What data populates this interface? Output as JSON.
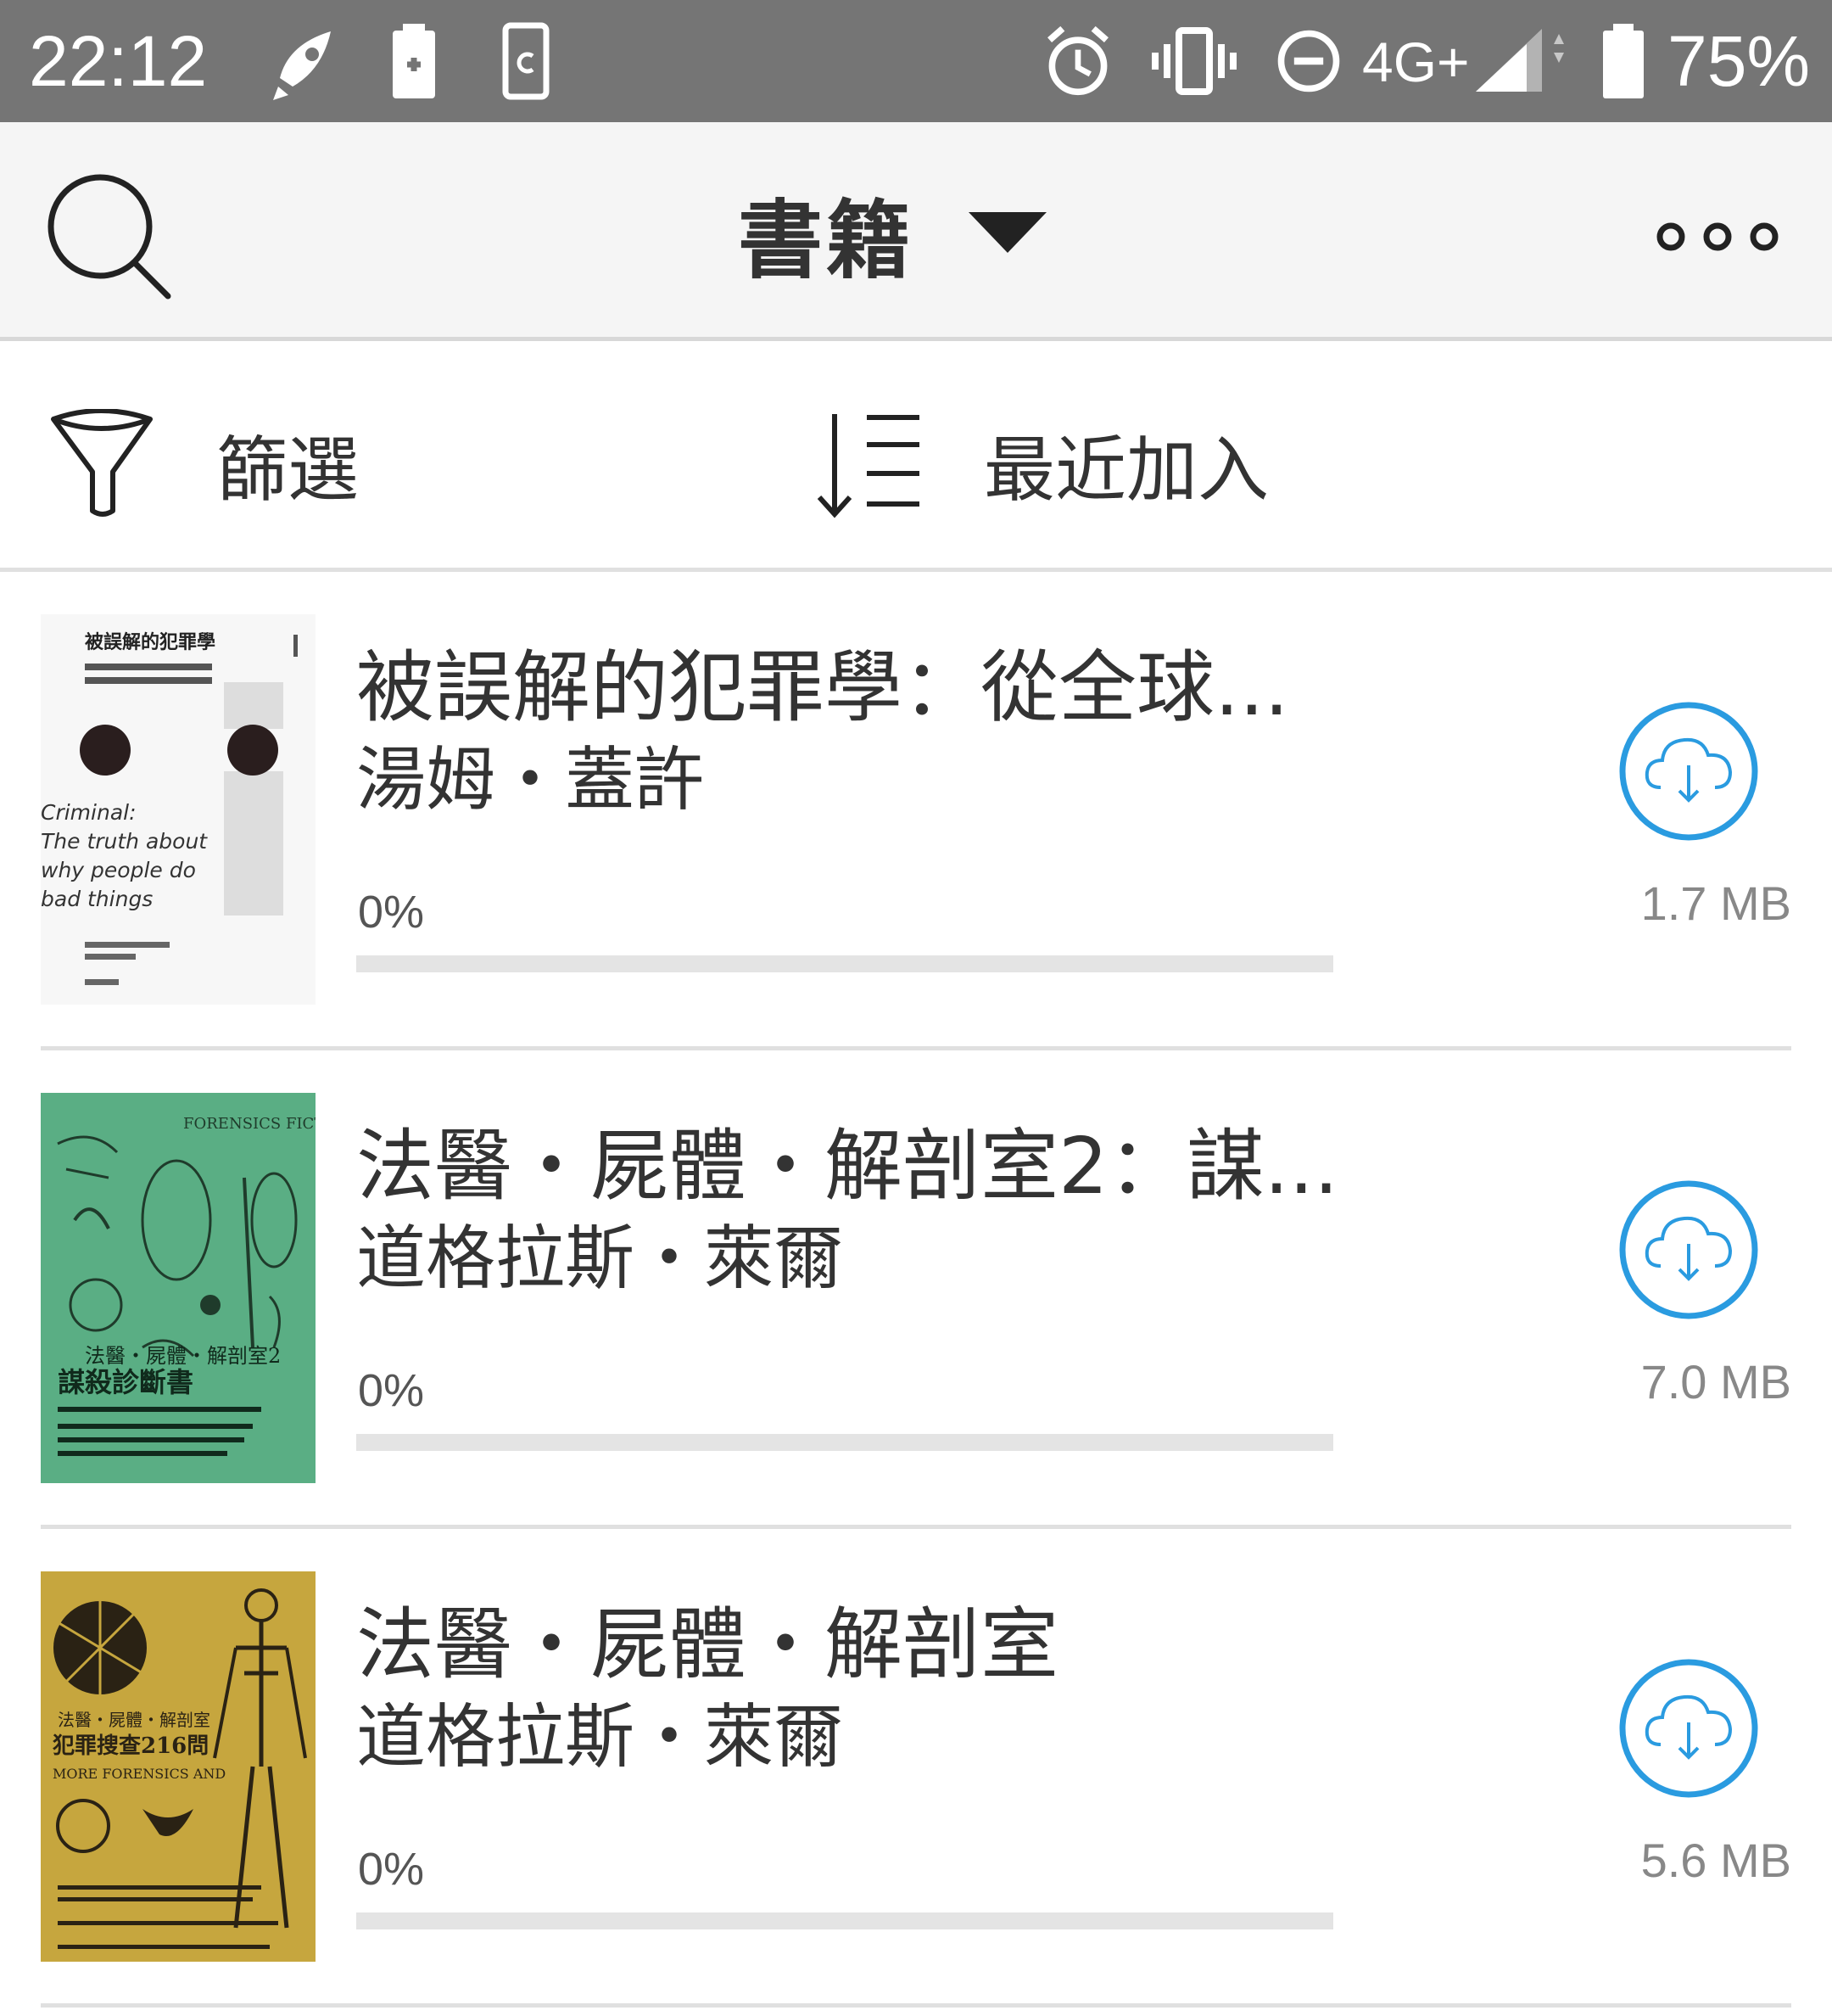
{
  "status_bar": {
    "time": "22:12",
    "network": "4G+",
    "battery_percent": "75%",
    "icons": [
      "rocket-icon",
      "battery-saver-icon",
      "screen-rotate-icon",
      "alarm-icon",
      "vibrate-icon",
      "do-not-disturb-icon",
      "signal-icon",
      "battery-icon"
    ]
  },
  "app_bar": {
    "title": "書籍",
    "icons": [
      "search-icon",
      "dropdown-arrow-icon",
      "more-options-icon"
    ]
  },
  "filter_bar": {
    "filter_label": "篩選",
    "sort_label": "最近加入",
    "icons": [
      "funnel-icon",
      "sort-descending-icon"
    ]
  },
  "books": [
    {
      "title": "被誤解的犯罪學：從全球...",
      "author": "湯姆・蓋許",
      "progress_text": "0%",
      "progress": 0,
      "size": "1.7 MB",
      "cover": {
        "bg": "#f7f7f7",
        "title": "被誤解的犯罪學",
        "english": [
          "Criminal:",
          "The truth about",
          "why people do",
          "bad things"
        ]
      }
    },
    {
      "title": "法醫・屍體・解剖室2：謀...",
      "author": "道格拉斯・萊爾",
      "progress_text": "0%",
      "progress": 0,
      "size": "7.0 MB",
      "cover": {
        "bg": "#5aae84",
        "title": "法醫・屍體・解剖室2",
        "subtitle": "謀殺診斷書",
        "english": "FORENSICS FICTION"
      }
    },
    {
      "title": "法醫・屍體・解剖室",
      "author": "道格拉斯・萊爾",
      "progress_text": "0%",
      "progress": 0,
      "size": "5.6 MB",
      "cover": {
        "bg": "#c6a63e",
        "title": "法醫・屍體・解剖室",
        "subtitle": "犯罪搜查216問",
        "english": "MORE FORENSICS AND"
      }
    }
  ],
  "colors": {
    "status_bar": "#757575",
    "app_bar": "#f5f5f5",
    "accent": "#2a9be0",
    "divider": "#e0e0e0"
  }
}
